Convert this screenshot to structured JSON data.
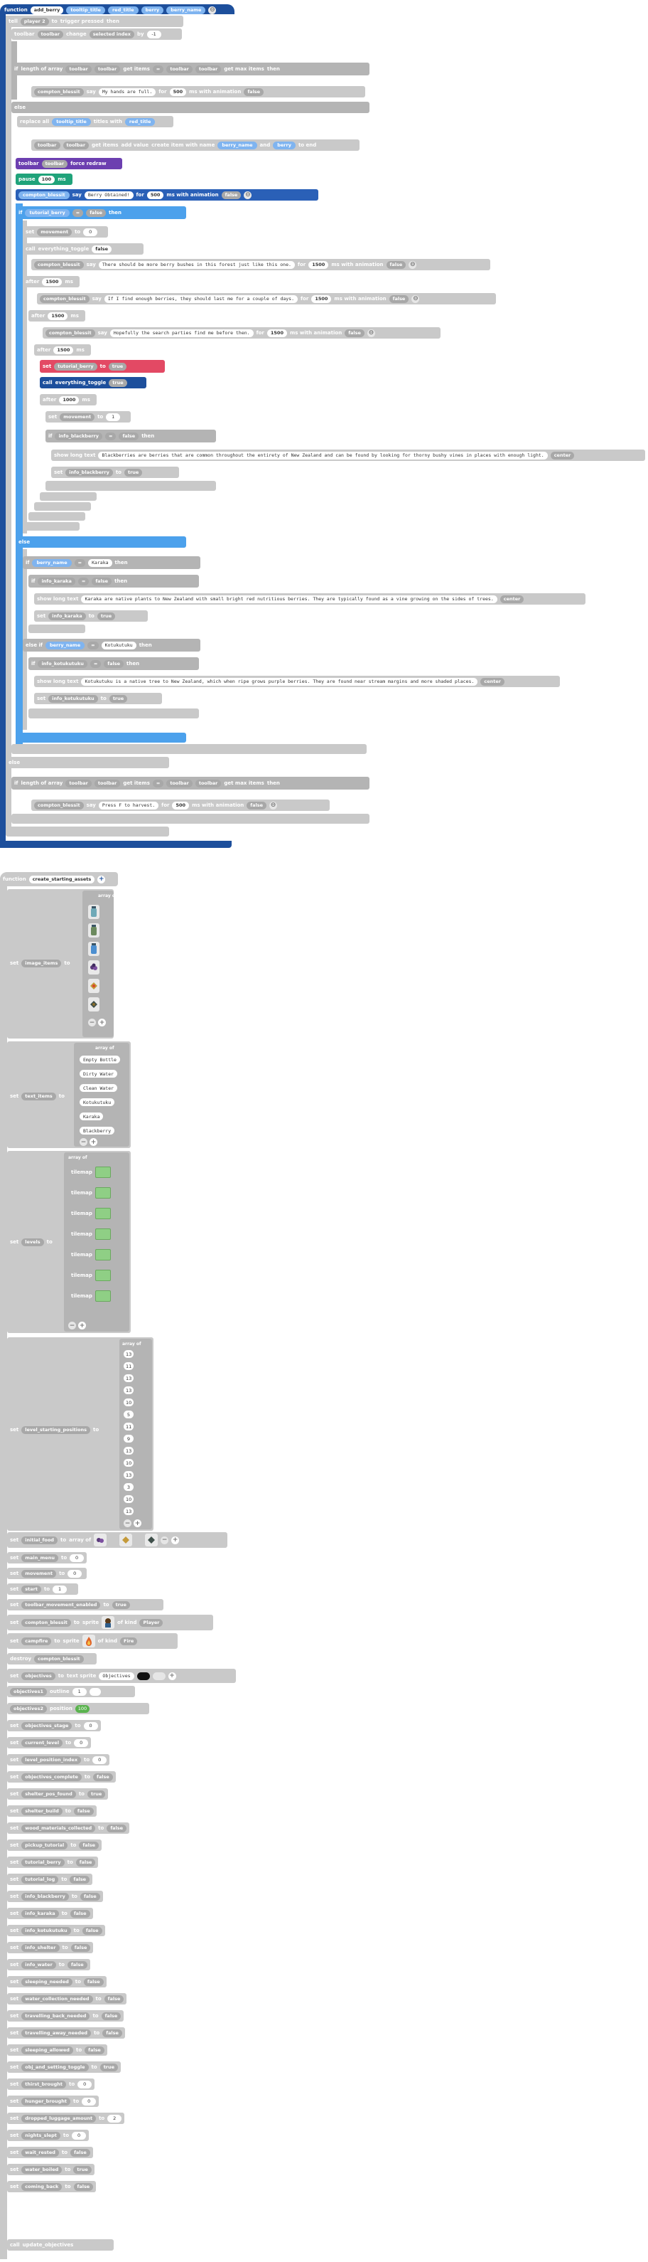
{
  "func1": {
    "keyword": "function",
    "name": "add_berry",
    "params": [
      "tooltip_title",
      "red_title",
      "berry",
      "berry_name"
    ],
    "line1": {
      "kw1": "tell",
      "kw2": "player 2",
      "kw3": "to",
      "kw4": "tooltip",
      "kw5": "trigger pressed",
      "kw6": "then"
    },
    "line2": {
      "kw1": "toolbar",
      "kw2": "toolbar",
      "kw3": "change",
      "kw4": "selected index",
      "kw5": "by",
      "val": "-1"
    },
    "if1": {
      "kw": "if",
      "kw2": "length of array",
      "a": "toolbar",
      "b": "toolbar",
      "c": "get items",
      "d": "=",
      "e": "toolbar",
      "f": "toolbar",
      "g": "get max items",
      "then": "then"
    },
    "say1": {
      "sprite": "compton_blessit",
      "say": "say",
      "text": "My hands are full.",
      "for": "for",
      "ms": "500",
      "anim": "ms with animation",
      "anim_val": "false"
    },
    "else": "else",
    "replace": {
      "kw": "replace all",
      "a": "tooltip_title",
      "b": "titles with",
      "c": "red_title"
    },
    "toolbar_get": {
      "a": "toolbar",
      "b": "toolbar",
      "c": "get items",
      "d": "add value",
      "e": "create item with name",
      "f": "berry_name",
      "g": "and",
      "h": "berry",
      "end": "to end"
    },
    "force_redraw": {
      "a": "toolbar",
      "b": "toolbar",
      "c": "force redraw"
    },
    "pause": {
      "kw": "pause",
      "ms": "100",
      "unit": "ms"
    },
    "say_berry": {
      "sprite": "compton_blessit",
      "say": "say",
      "text": "Berry Obtained!",
      "for": "for",
      "ms": "500",
      "anim": "ms with animation",
      "anim_val": "false"
    },
    "if2": {
      "kw": "if",
      "a": "tutorial_berry",
      "b": "=",
      "c": "false",
      "then": "then"
    },
    "set_zero": {
      "set": "set",
      "var": "movement",
      "to": "to",
      "val": "0"
    },
    "call_toggle": {
      "call": "call",
      "name": "everything_toggle",
      "val": "false"
    },
    "say_more": {
      "sprite": "compton_blessit",
      "say": "say",
      "text": "There should be more berry bushes in this forest just like this one.",
      "for": "for",
      "ms": "1500",
      "anim": "ms with animation",
      "anim_val": "false"
    },
    "after1": {
      "kw": "after",
      "ms": "1500",
      "unit": "ms"
    },
    "say_find": {
      "sprite": "compton_blessit",
      "say": "say",
      "text": "If I find enough berries, they should last me for a couple of days.",
      "for": "for",
      "ms": "1500",
      "anim": "ms with animation",
      "anim_val": "false"
    },
    "after2": {
      "kw": "after",
      "ms": "1500",
      "unit": "ms"
    },
    "say_hope": {
      "sprite": "compton_blessit",
      "say": "say",
      "text": "Hopefully the search parties find me before then.",
      "for": "for",
      "ms": "1500",
      "anim": "ms with animation",
      "anim_val": "false"
    },
    "after3": {
      "kw": "after",
      "ms": "1500",
      "unit": "ms"
    },
    "set_tut": {
      "set": "set",
      "var": "tutorial_berry",
      "to": "to",
      "val": "true"
    },
    "call_toggle2": {
      "call": "call",
      "name": "everything_toggle",
      "val": "true"
    },
    "after4": {
      "kw": "after",
      "ms": "1000",
      "unit": "ms"
    },
    "set_move": {
      "set": "set",
      "var": "movement",
      "to": "to",
      "val": "1"
    },
    "if3": {
      "kw": "if",
      "a": "info_blackberry",
      "b": "=",
      "c": "false",
      "then": "then"
    },
    "show_black": {
      "kw": "show long text",
      "text": "Blackberries are berries that are common throughout the entirety of New Zealand and can be found by looking for thorny bushy vines in places with enough light.",
      "pos": "center"
    },
    "set_black": {
      "set": "set",
      "var": "info_blackberry",
      "to": "to",
      "val": "true"
    },
    "else2": "else",
    "if_karaka": {
      "kw": "if",
      "a": "berry_name",
      "b": "=",
      "c": "Karaka",
      "then": "then"
    },
    "if_karaka2": {
      "kw": "if",
      "a": "info_karaka",
      "b": "=",
      "c": "false",
      "then": "then"
    },
    "show_karaka": {
      "kw": "show long text",
      "text": "Karaka are native plants to New Zealand with small bright red nutritious berries. They are typically found as a vine growing on the sides of trees.",
      "pos": "center"
    },
    "set_karaka": {
      "set": "set",
      "var": "info_karaka",
      "to": "to",
      "val": "true"
    },
    "elseif": {
      "kw": "else if",
      "a": "berry_name",
      "b": "=",
      "c": "Kotukutuku",
      "then": "then"
    },
    "if_koto": {
      "kw": "if",
      "a": "info_kotukutuku",
      "b": "=",
      "c": "false",
      "then": "then"
    },
    "show_koto": {
      "kw": "show long text",
      "text": "Kotukutuku is a native tree to New Zealand, which when ripe grows purple berries. They are found near stream margins and more shaded places.",
      "pos": "center"
    },
    "set_koto": {
      "set": "set",
      "var": "info_kotukutuku",
      "to": "to",
      "val": "true"
    },
    "else3": "else",
    "if4": {
      "kw": "if",
      "kw2": "length of array",
      "a": "toolbar",
      "b": "toolbar",
      "c": "get items",
      "d": "=",
      "e": "toolbar",
      "f": "toolbar",
      "g": "get max items",
      "then": "then"
    },
    "say_harvest": {
      "sprite": "compton_blessit",
      "say": "say",
      "text": "Press F to harvest.",
      "for": "for",
      "ms": "500",
      "anim": "ms with animation",
      "anim_val": "false"
    }
  },
  "func2": {
    "keyword": "function",
    "name": "create_starting_assets",
    "set_image": {
      "set": "set",
      "var": "image_items",
      "to": "to",
      "array": "array of"
    },
    "set_text": {
      "set": "set",
      "var": "text_items",
      "to": "to",
      "array": "array of",
      "items": [
        "Empty Bottle",
        "Dirty Water",
        "Clean Water",
        "Kotukutuku",
        "Karaka",
        "Blackberry"
      ]
    },
    "set_levels": {
      "set": "set",
      "var": "levels",
      "to": "to",
      "array": "array of",
      "tilemap": "tilemap",
      "count": 7
    },
    "set_positions": {
      "set": "set",
      "var": "level_starting_positions",
      "to": "to",
      "array": "array of",
      "items": [
        "13",
        "11",
        "13",
        "13",
        "10",
        "5",
        "11",
        "9",
        "13",
        "10",
        "13",
        "3",
        "10",
        "13"
      ]
    },
    "set_initial_food": {
      "set": "set",
      "var": "initial_food",
      "to": "to",
      "array": "array of"
    },
    "simple": [
      {
        "set": "set",
        "var": "main_menu",
        "to": "to",
        "val": "0"
      },
      {
        "set": "set",
        "var": "movement",
        "to": "to",
        "val": "0"
      },
      {
        "set": "set",
        "var": "start",
        "to": "to",
        "val": "1"
      }
    ],
    "toolbar_moved": {
      "set": "set",
      "var": "toolbar_movement_enabled",
      "to": "to",
      "val": "true"
    },
    "compton": {
      "set": "set",
      "var": "compton_blessit",
      "to": "to",
      "kw": "sprite",
      "kind": "of kind",
      "kindval": "Player"
    },
    "campfire": {
      "set": "set",
      "var": "campfire",
      "to": "to",
      "kw": "sprite",
      "kind": "of kind",
      "kindval": "Fire"
    },
    "destroy": {
      "kw": "destroy",
      "var": "compton_blessit"
    },
    "objectives": {
      "set": "set",
      "var": "objectives",
      "to": "to",
      "kw": "text sprite",
      "text": "Objectives"
    },
    "obj_outline": {
      "var": "objectives1",
      "kw": "outline",
      "val": "1"
    },
    "obj_position": {
      "var": "objectives2",
      "kw": "position",
      "val": "100"
    },
    "obj_rest": [
      {
        "set": "set",
        "var": "objectives_stage",
        "to": "to",
        "val": "0"
      },
      {
        "set": "set",
        "var": "current_level",
        "to": "to",
        "val": "0"
      },
      {
        "set": "set",
        "var": "level_position_index",
        "to": "to",
        "val": "0"
      },
      {
        "set": "set",
        "var": "objectives_complete",
        "to": "to",
        "val": "false"
      },
      {
        "set": "set",
        "var": "shelter_pos_found",
        "to": "to",
        "val": "true"
      },
      {
        "set": "set",
        "var": "shelter_build",
        "to": "to",
        "val": "false"
      },
      {
        "set": "set",
        "var": "wood_materials_collected",
        "to": "to",
        "val": "false"
      },
      {
        "set": "set",
        "var": "pickup_tutorial",
        "to": "to",
        "val": "false"
      },
      {
        "set": "set",
        "var": "tutorial_berry",
        "to": "to",
        "val": "false"
      },
      {
        "set": "set",
        "var": "tutorial_log",
        "to": "to",
        "val": "false"
      },
      {
        "set": "set",
        "var": "info_blackberry",
        "to": "to",
        "val": "false"
      },
      {
        "set": "set",
        "var": "info_karaka",
        "to": "to",
        "val": "false"
      },
      {
        "set": "set",
        "var": "info_kotukutuku",
        "to": "to",
        "val": "false"
      },
      {
        "set": "set",
        "var": "info_shelter",
        "to": "to",
        "val": "false"
      },
      {
        "set": "set",
        "var": "info_water",
        "to": "to",
        "val": "false"
      },
      {
        "set": "set",
        "var": "sleeping_needed",
        "to": "to",
        "val": "false"
      },
      {
        "set": "set",
        "var": "water_collection_needed",
        "to": "to",
        "val": "false"
      },
      {
        "set": "set",
        "var": "travelling_back_needed",
        "to": "to",
        "val": "false"
      },
      {
        "set": "set",
        "var": "travelling_away_needed",
        "to": "to",
        "val": "false"
      },
      {
        "set": "set",
        "var": "sleeping_allowed",
        "to": "to",
        "val": "false"
      },
      {
        "set": "set",
        "var": "obj_and_setting_toggle",
        "to": "to",
        "val": "true"
      },
      {
        "set": "set",
        "var": "thirst_brought",
        "to": "to",
        "val": "0"
      },
      {
        "set": "set",
        "var": "hunger_brought",
        "to": "to",
        "val": "0"
      },
      {
        "set": "set",
        "var": "dropped_luggage_amount",
        "to": "to",
        "val": "2"
      },
      {
        "set": "set",
        "var": "nights_slept",
        "to": "to",
        "val": "0"
      },
      {
        "set": "set",
        "var": "wait_rested",
        "to": "to",
        "val": "false"
      },
      {
        "set": "set",
        "var": "water_boiled",
        "to": "to",
        "val": "true"
      },
      {
        "set": "set",
        "var": "coming_back",
        "to": "to",
        "val": "false"
      }
    ],
    "call_update": {
      "call": "call",
      "name": "update_objectives"
    }
  }
}
